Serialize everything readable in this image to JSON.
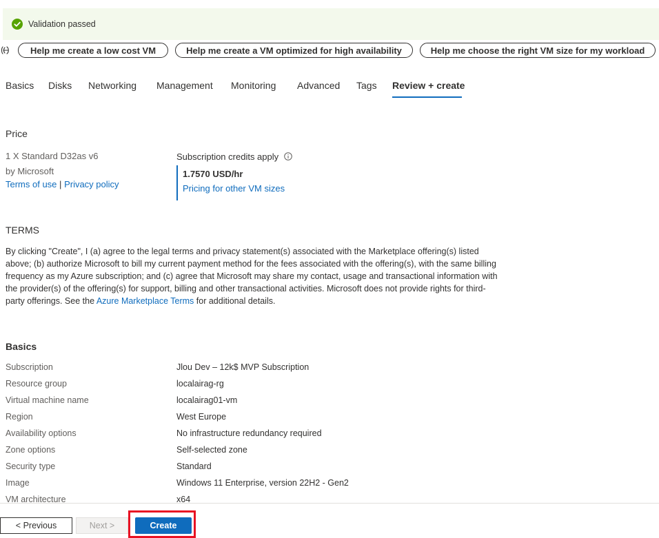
{
  "validation": {
    "text": "Validation passed",
    "color": "#57a300"
  },
  "copilot": {
    "icon": "copilot-icon",
    "suggestions": [
      "Help me create a low cost VM",
      "Help me create a VM optimized for high availability",
      "Help me choose the right VM size for my workload"
    ]
  },
  "tabs": [
    "Basics",
    "Disks",
    "Networking",
    "Management",
    "Monitoring",
    "Advanced",
    "Tags",
    "Review + create"
  ],
  "active_tab": "Review + create",
  "price": {
    "heading": "Price",
    "product": "1 X Standard D32as v6",
    "publisher": "by Microsoft",
    "terms_link": "Terms of use",
    "separator": "|",
    "privacy_link": "Privacy policy",
    "credits_label": "Subscription credits apply",
    "amount": "1.7570 USD/hr",
    "pricing_link": "Pricing for other VM sizes"
  },
  "terms": {
    "heading": "TERMS",
    "text_before": "By clicking \"Create\", I (a) agree to the legal terms and privacy statement(s) associated with the Marketplace offering(s) listed above; (b) authorize Microsoft to bill my current payment method for the fees associated with the offering(s), with the same billing frequency as my Azure subscription; and (c) agree that Microsoft may share my contact, usage and transactional information with the provider(s) of the offering(s) for support, billing and other transactional activities. Microsoft does not provide rights for third-party offerings. See the ",
    "link": "Azure Marketplace Terms",
    "text_after": " for additional details."
  },
  "basics": {
    "heading": "Basics",
    "rows": [
      {
        "label": "Subscription",
        "value": "Jlou Dev – 12k$ MVP Subscription"
      },
      {
        "label": "Resource group",
        "value": "localairag-rg"
      },
      {
        "label": "Virtual machine name",
        "value": "localairag01-vm"
      },
      {
        "label": "Region",
        "value": "West Europe"
      },
      {
        "label": "Availability options",
        "value": "No infrastructure redundancy required"
      },
      {
        "label": "Zone options",
        "value": "Self-selected zone"
      },
      {
        "label": "Security type",
        "value": "Standard"
      },
      {
        "label": "Image",
        "value": "Windows 11 Enterprise, version 22H2 - Gen2"
      },
      {
        "label": "VM architecture",
        "value": "x64"
      }
    ]
  },
  "footer": {
    "previous": "< Previous",
    "next": "Next >",
    "create": "Create"
  },
  "colors": {
    "accent": "#0f6cbd",
    "highlight": "#e81123",
    "success_bg": "#f3f9ec"
  }
}
